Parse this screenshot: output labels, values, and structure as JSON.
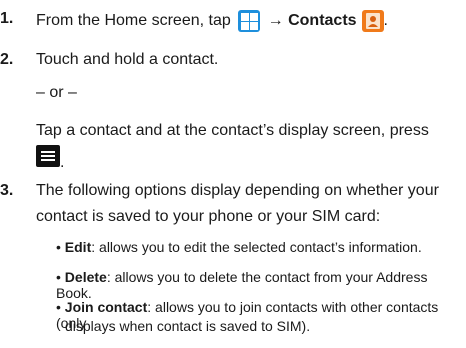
{
  "steps": [
    {
      "num": "1.",
      "text_before": "From the Home screen, tap ",
      "arrow": "→",
      "bold_text": "Contacts",
      "period": "."
    },
    {
      "num": "2.",
      "text": "Touch and hold a contact.",
      "or_text": "– or –",
      "alt_line1": "Tap a contact and at the contact’s display screen, press",
      "alt_period": "."
    },
    {
      "num": "3.",
      "line1": "The following options display depending on whether your",
      "line2": "contact is saved to your phone or your SIM card:"
    }
  ],
  "options": [
    {
      "label": "Edit",
      "desc": ": allows you to edit the selected contact’s information."
    },
    {
      "label": "Delete",
      "desc": ": allows you to delete the contact from your Address Book."
    },
    {
      "label": "Join contact",
      "desc": ": allows you to join contacts with other contacts (only",
      "desc2": "displays when contact is saved to SIM)."
    }
  ],
  "bullet_char": "•",
  "icons": {
    "apps": "apps-grid-icon",
    "contacts": "contacts-app-icon",
    "menu": "menu-key-icon"
  },
  "colors": {
    "apps_icon": "#1e8fdc",
    "contacts_icon": "#f07a1a",
    "menu_key": "#111111"
  }
}
